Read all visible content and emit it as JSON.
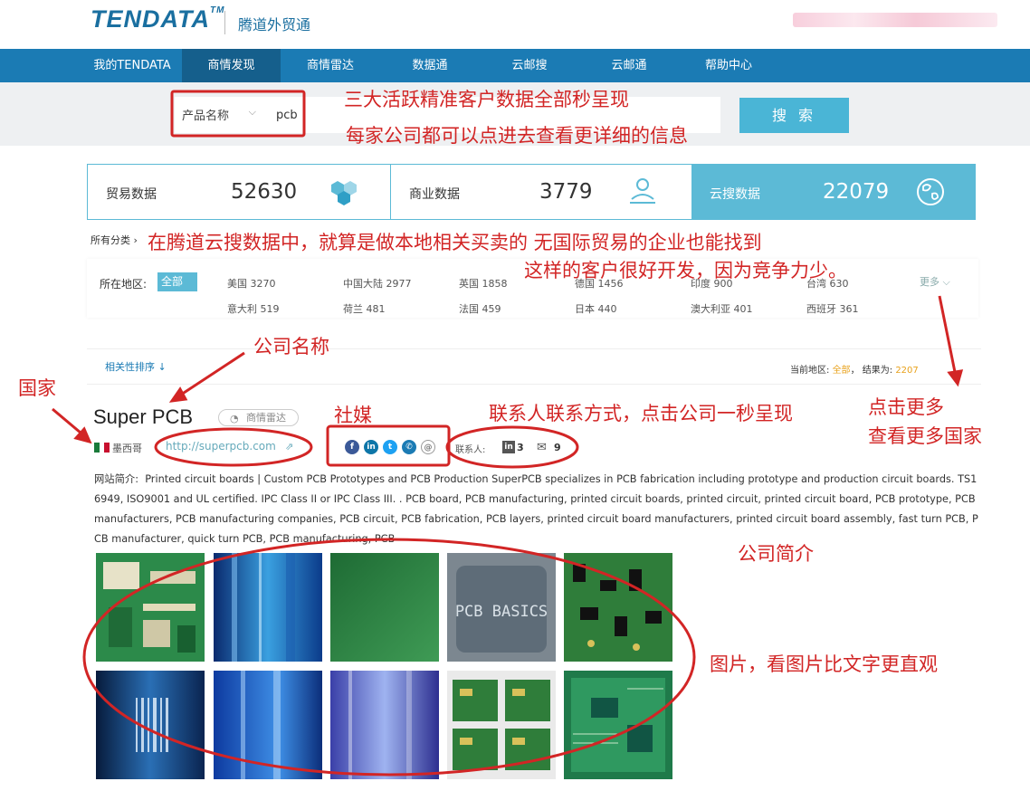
{
  "header": {
    "logo": "TENDATA",
    "logo_tm": "TM",
    "subtitle": "腾道外贸通"
  },
  "nav": [
    {
      "label": "我的TENDATA"
    },
    {
      "label": "商情发现"
    },
    {
      "label": "商情雷达"
    },
    {
      "label": "数据通"
    },
    {
      "label": "云邮搜"
    },
    {
      "label": "云邮通"
    },
    {
      "label": "帮助中心"
    }
  ],
  "search": {
    "field_select": "产品名称",
    "value": "pcb",
    "button": "搜 索"
  },
  "stats": [
    {
      "label": "贸易数据",
      "value": "52630",
      "icon": "hexagons-icon"
    },
    {
      "label": "商业数据",
      "value": "3779",
      "icon": "handshake-icon"
    },
    {
      "label": "云搜数据",
      "value": "22079",
      "icon": "globe-icon"
    }
  ],
  "category": {
    "all_label": "所有分类"
  },
  "regions": {
    "label": "所在地区:",
    "all": "全部",
    "items": [
      "美国 3270",
      "中国大陆 2977",
      "英国 1858",
      "德国 1456",
      "印度 900",
      "台湾 630",
      "意大利 519",
      "荷兰 481",
      "法国 459",
      "日本 440",
      "澳大利亚 401",
      "西班牙 361"
    ],
    "more": "更多"
  },
  "sort": {
    "label": "相关性排序",
    "current_region_label": "当前地区:",
    "current_region_value": "全部",
    "results_label": "结果为:",
    "results_value": "2207"
  },
  "company": {
    "name": "Super PCB",
    "badge": "商情雷达",
    "country": "墨西哥",
    "website": "http://superpcb.com",
    "social": [
      "facebook-icon",
      "linkedin-icon",
      "twitter-icon",
      "phone-icon",
      "email-circle-icon"
    ],
    "contact_label": "联系人:",
    "linkedin_count": "3",
    "mail_count": "9",
    "description_label": "网站简介:",
    "description": "Printed circuit boards | Custom PCB Prototypes and PCB Production SuperPCB specializes in PCB fabrication including prototype and production circuit boards. TS16949, ISO9001 and UL certified. IPC Class II or IPC Class III. . PCB board, PCB manufacturing, printed circuit boards, printed circuit, printed circuit board, PCB prototype, PCB manufacturers, PCB manufacturing companies, PCB circuit, PCB fabrication, PCB layers, printed circuit board manufacturers, printed circuit board assembly, fast turn PCB, PCB manufacturer, quick turn PCB, PCB manufacturing, PCB",
    "image_text": "PCB BASICS"
  },
  "annotations": {
    "a1": "三大活跃精准客户数据全部秒呈现",
    "a2": "每家公司都可以点进去查看更详细的信息",
    "a3": "在腾道云搜数据中，就算是做本地相关买卖的 无国际贸易的企业也能找到",
    "a4": "这样的客户很好开发，因为竞争力少。",
    "company_name": "公司名称",
    "country": "国家",
    "social": "社媒",
    "contact": "联系人联系方式，点击公司一秒呈现",
    "more1": "点击更多",
    "more2": "查看更多国家",
    "intro": "公司简介",
    "images": "图片，看图片比文字更直观"
  },
  "colors": {
    "nav_bg": "#1b7bb4",
    "accent": "#5cbad6",
    "annotation": "#d22525",
    "highlight": "#e8a11b"
  }
}
